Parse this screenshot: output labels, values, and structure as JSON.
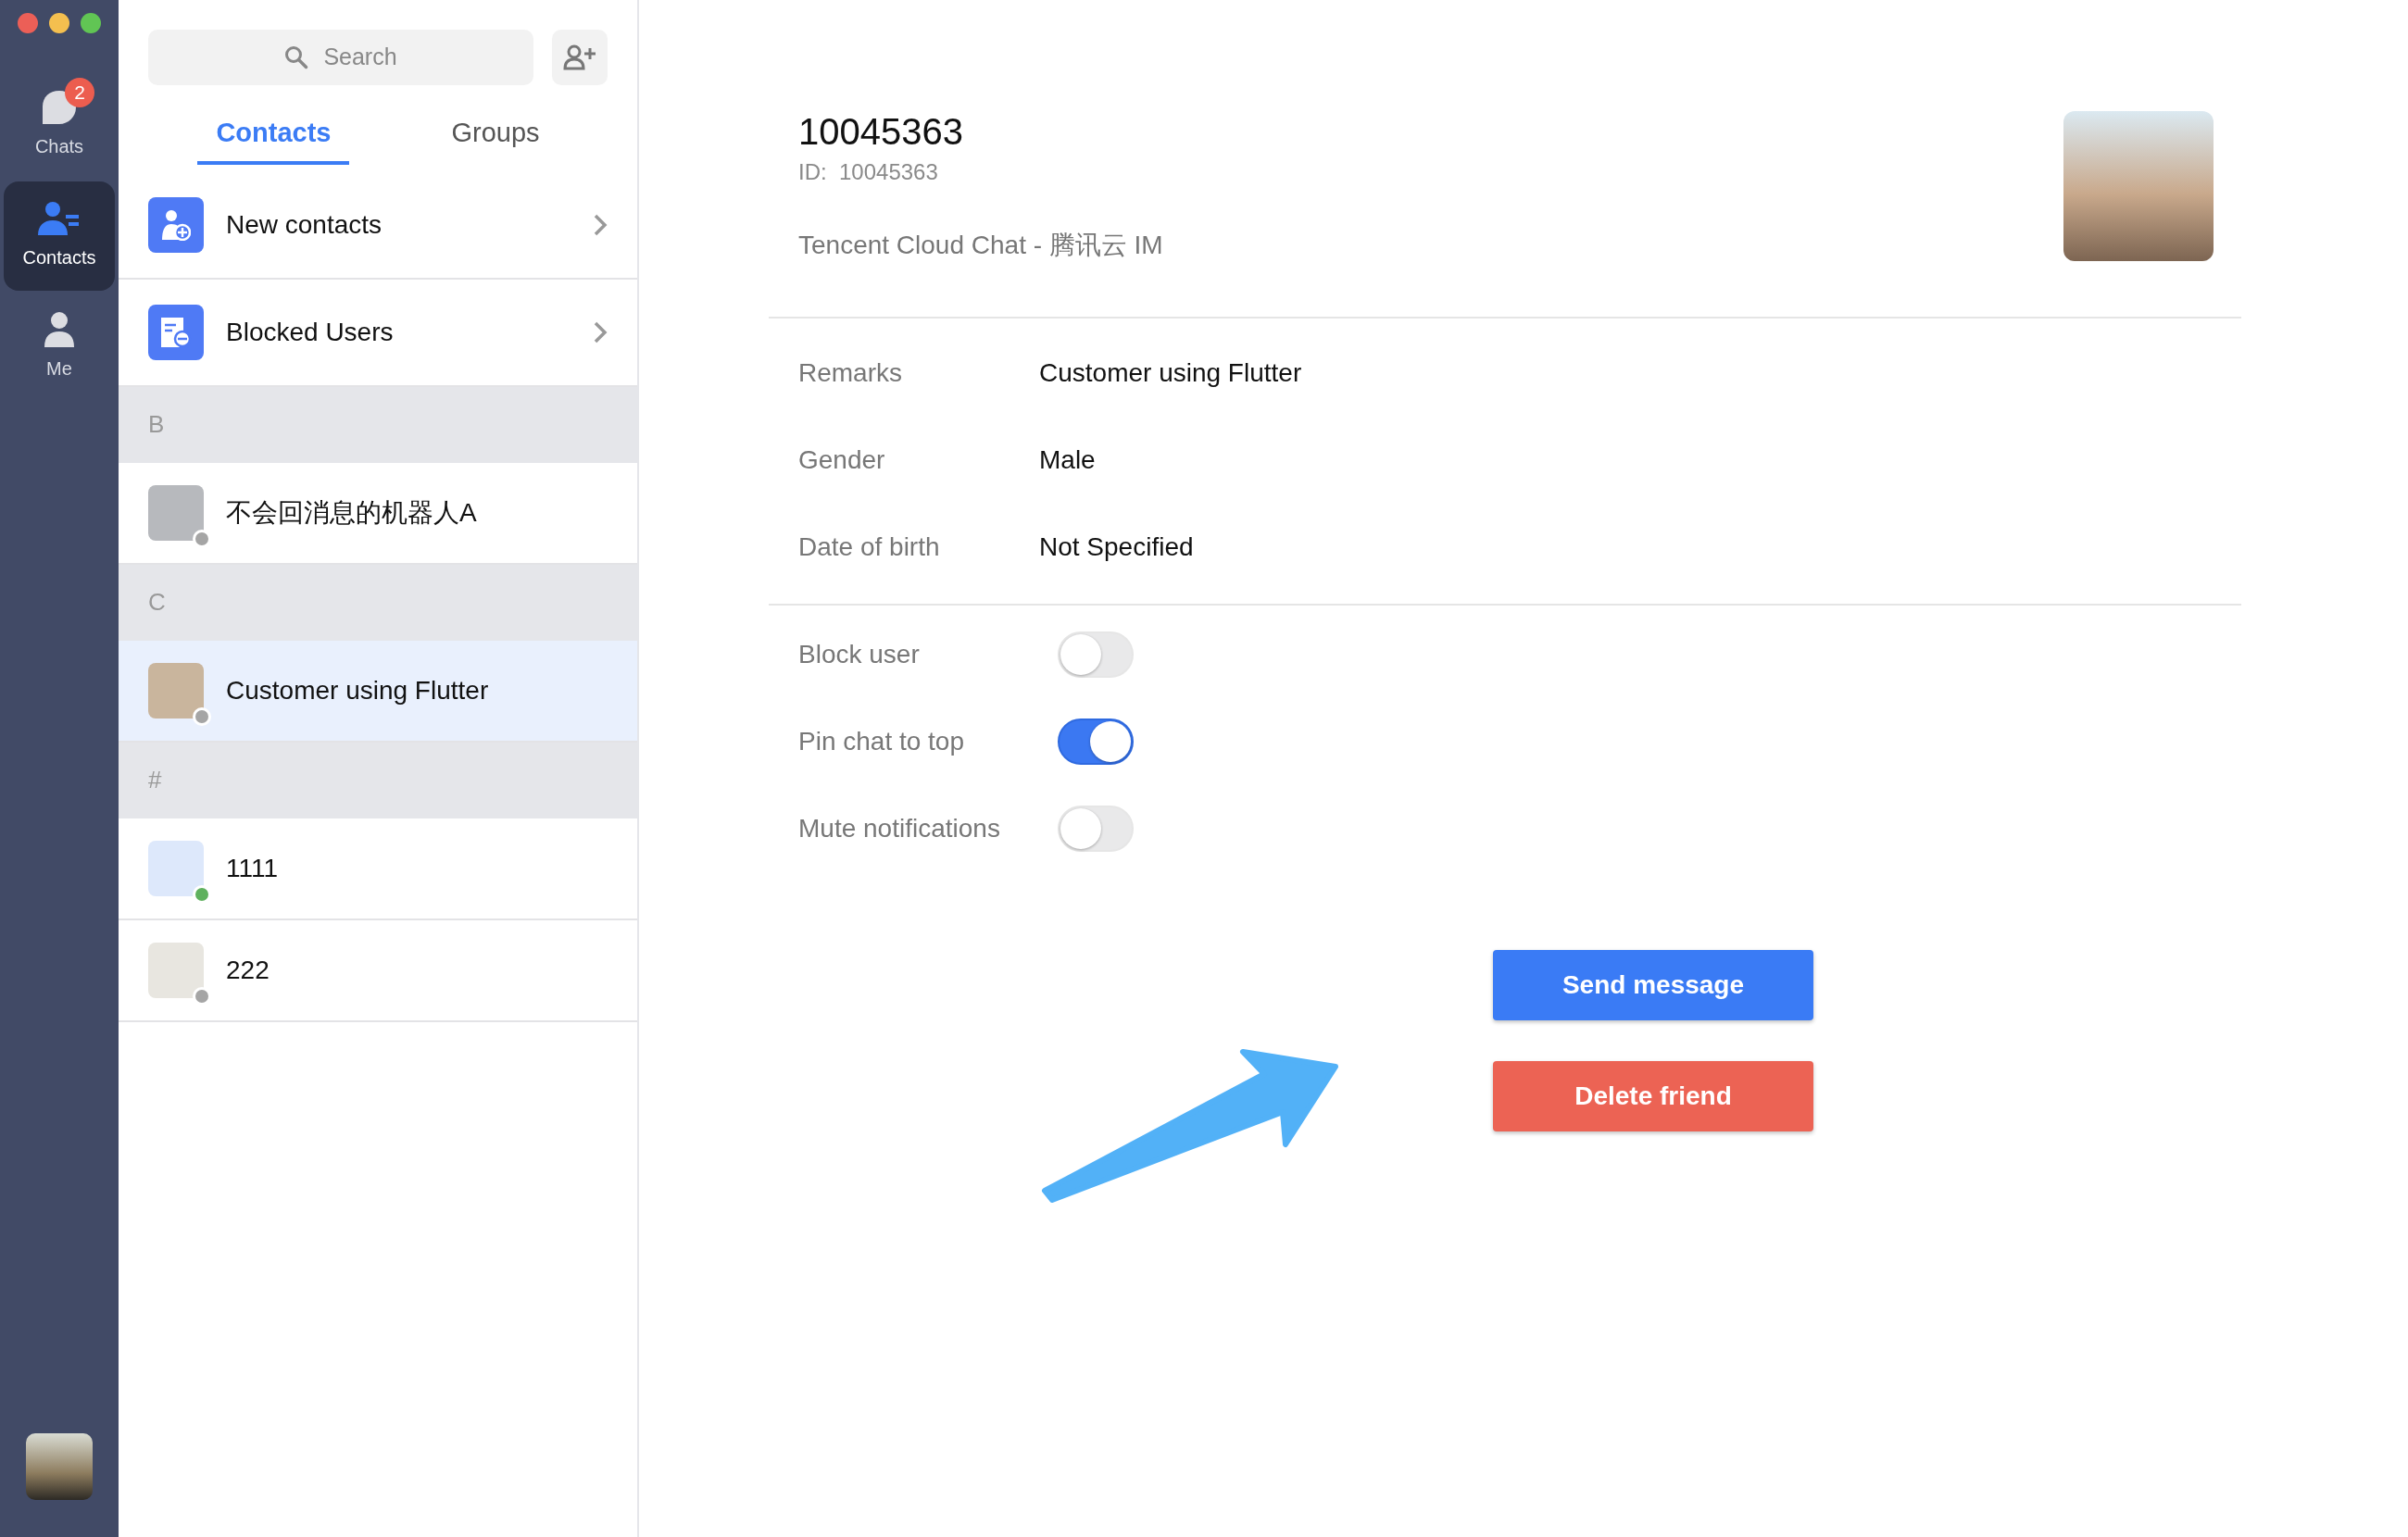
{
  "nav_rail": {
    "items": [
      {
        "label": "Chats",
        "kind": "chats",
        "selected": false,
        "badge": "2"
      },
      {
        "label": "Contacts",
        "kind": "contacts",
        "selected": true
      },
      {
        "label": "Me",
        "kind": "me",
        "selected": false
      }
    ]
  },
  "contacts_panel": {
    "search": {
      "placeholder": "Search"
    },
    "tabs": [
      {
        "label": "Contacts",
        "selected": true
      },
      {
        "label": "Groups",
        "selected": false
      }
    ],
    "shortcuts": [
      {
        "label": "New contacts",
        "kind": "new"
      },
      {
        "label": "Blocked Users",
        "kind": "blocked"
      }
    ],
    "sections": [
      {
        "letter": "B",
        "contacts": [
          {
            "name": "不会回消息的机器人A",
            "selected": false,
            "online": false
          }
        ]
      },
      {
        "letter": "C",
        "contacts": [
          {
            "name": "Customer using Flutter",
            "selected": true,
            "online": false
          }
        ]
      },
      {
        "letter": "#",
        "contacts": [
          {
            "name": "1111",
            "selected": false,
            "online": true
          },
          {
            "name": "222",
            "selected": false,
            "online": false
          }
        ]
      }
    ]
  },
  "profile": {
    "name": "10045363",
    "id_label": "ID:",
    "id": "10045363",
    "signature": "Tencent Cloud Chat - 腾讯云 IM",
    "fields": [
      {
        "label": "Remarks",
        "value": "Customer using Flutter"
      },
      {
        "label": "Gender",
        "value": "Male"
      },
      {
        "label": "Date of birth",
        "value": "Not Specified"
      }
    ],
    "settings": [
      {
        "label": "Block user",
        "on": false
      },
      {
        "label": "Pin chat to top",
        "on": true
      },
      {
        "label": "Mute notifications",
        "on": false
      }
    ],
    "buttons": [
      {
        "label": "Send message",
        "kind": "primary"
      },
      {
        "label": "Delete friend",
        "kind": "danger"
      }
    ]
  }
}
